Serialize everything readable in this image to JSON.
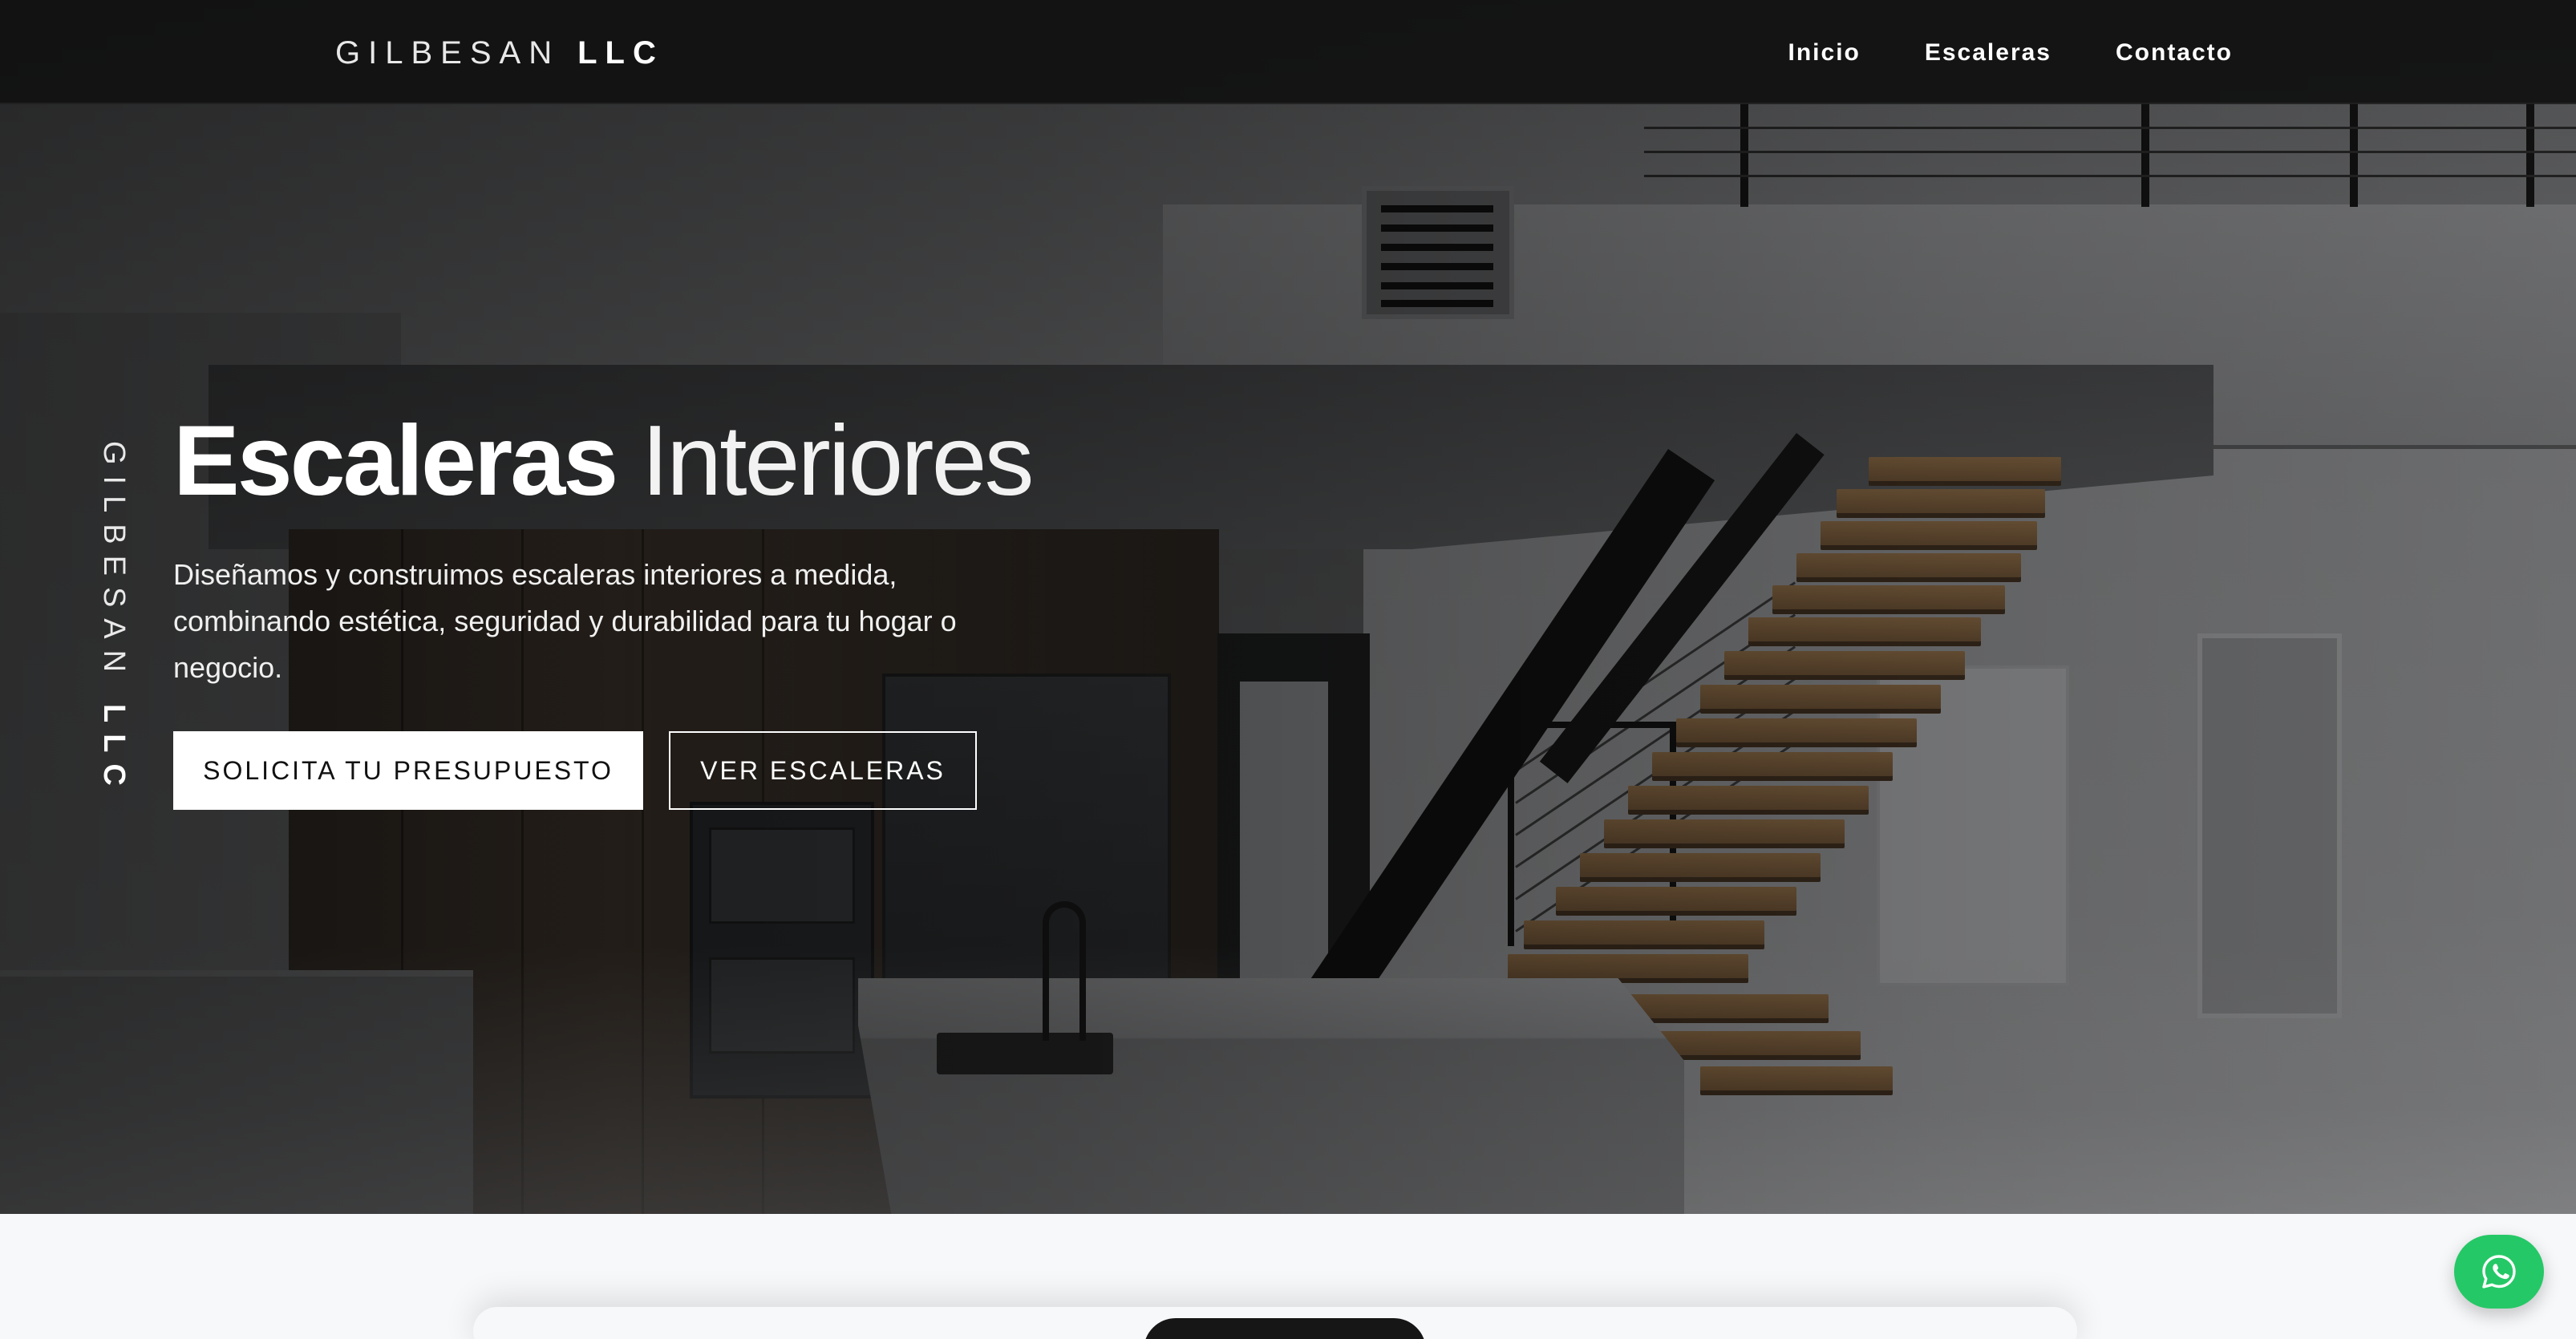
{
  "brand": {
    "name_light": "GILBESAN",
    "name_bold": "LLC"
  },
  "nav": {
    "items": [
      {
        "label": "Inicio"
      },
      {
        "label": "Escaleras"
      },
      {
        "label": "Contacto"
      }
    ]
  },
  "side_brand": {
    "name_light": "GILBESAN",
    "name_bold": "LLC"
  },
  "hero": {
    "title_bold": "Escaleras",
    "title_light": "Interiores",
    "description": "Diseñamos y construimos escaleras interiores a medida, combinando estética, seguridad y durabilidad para tu hogar o negocio.",
    "primary_button": "SOLICITA TU PRESUPUESTO",
    "secondary_button": "VER ESCALERAS"
  },
  "whatsapp": {
    "icon": "whatsapp-icon"
  },
  "colors": {
    "navbar_bg": "#121212",
    "primary_button_bg": "#ffffff",
    "whatsapp_green": "#25c866",
    "section_bg": "#f7f8fa"
  }
}
